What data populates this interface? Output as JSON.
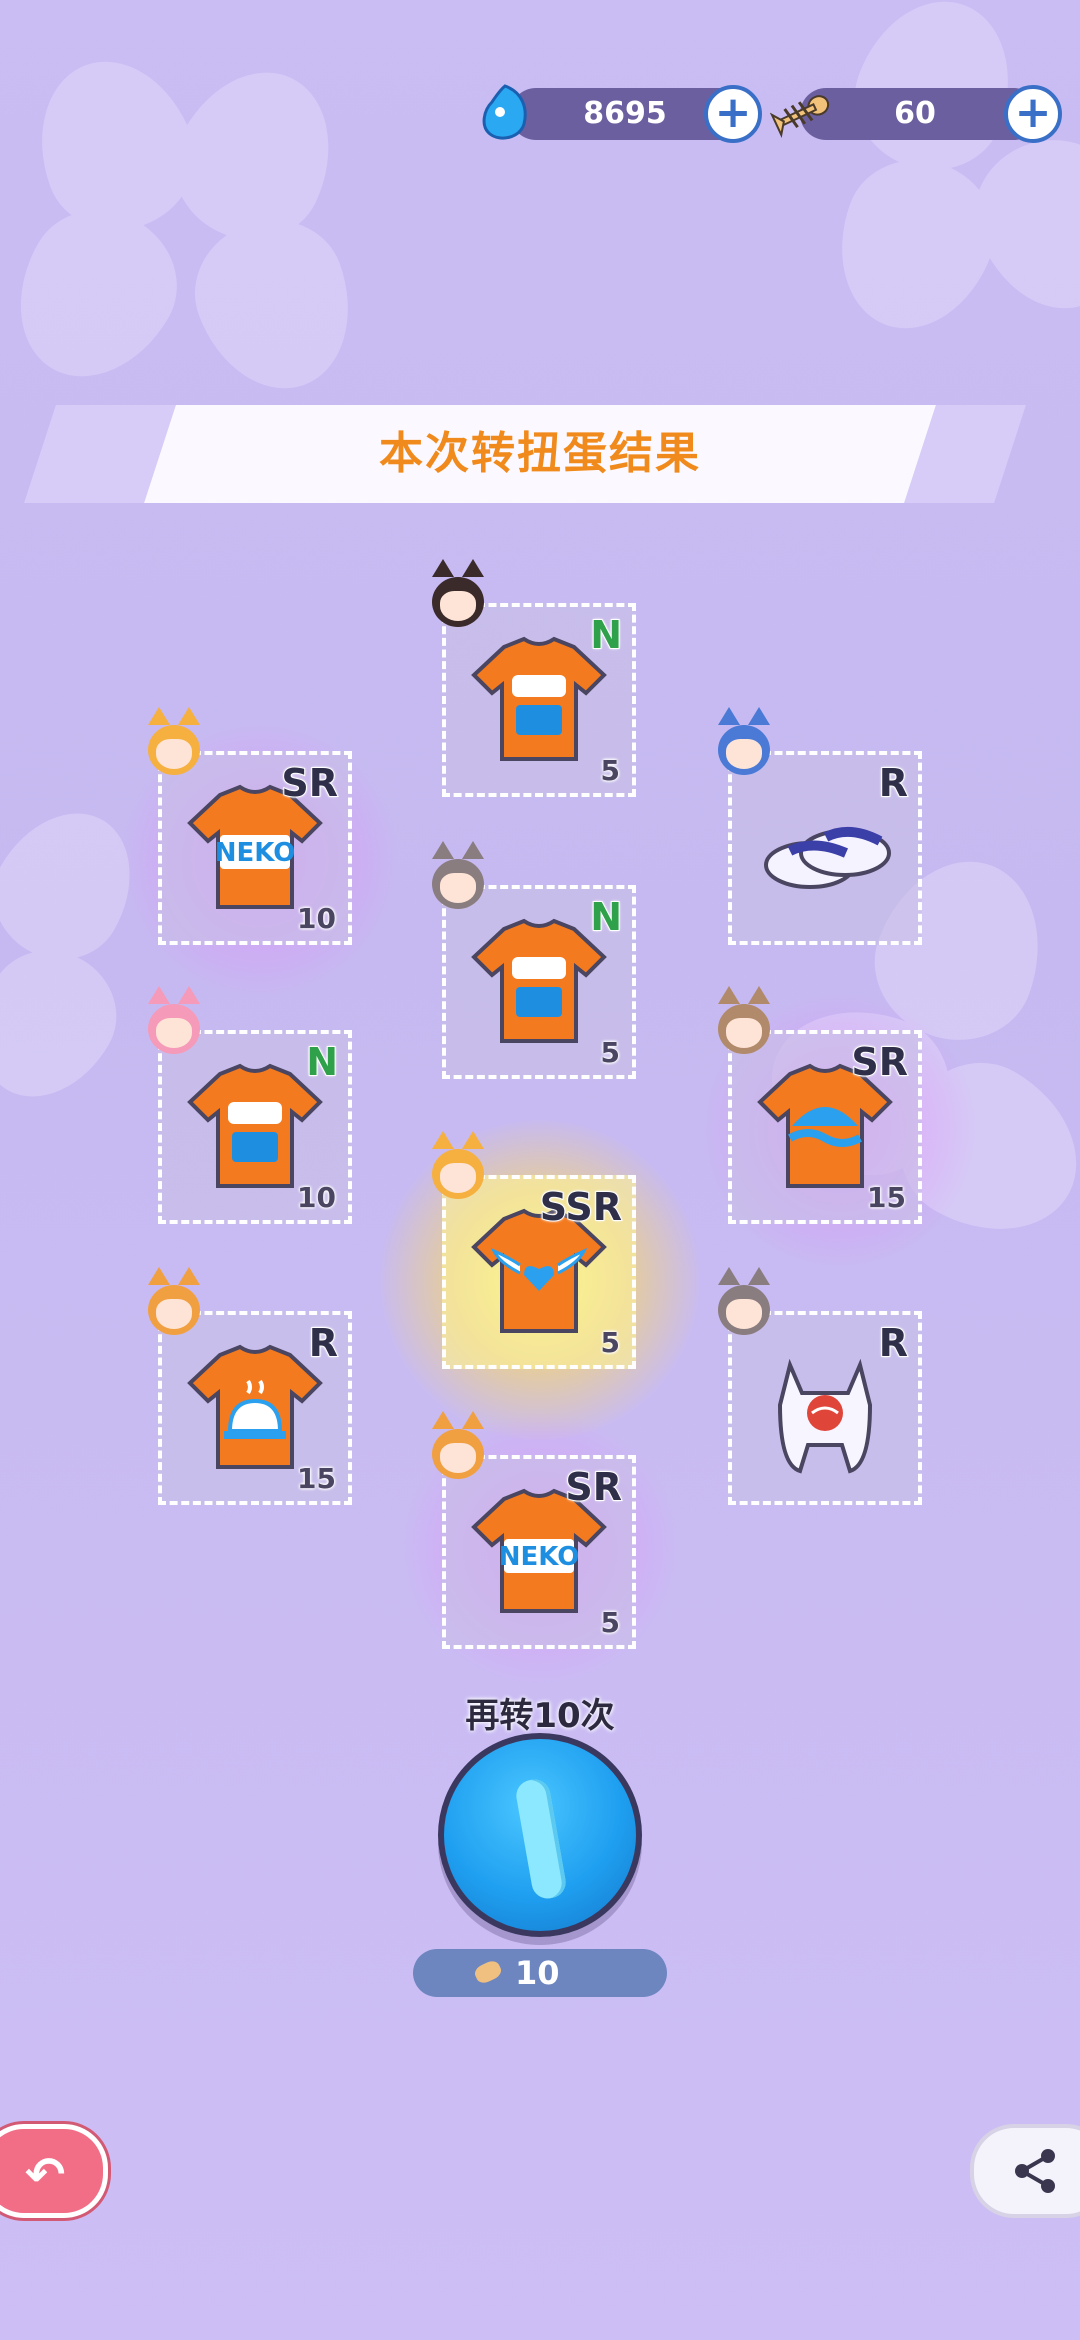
{
  "currencies": [
    {
      "name": "gem",
      "value": "8695",
      "icon": "gem-icon"
    },
    {
      "name": "fishbone",
      "value": "60",
      "icon": "fishbone-icon"
    }
  ],
  "banner": {
    "title": "本次转扭蛋结果"
  },
  "cards": [
    {
      "rarity": "N",
      "count": "5",
      "item": "tshirt-pangcilang",
      "slot": "top-center"
    },
    {
      "rarity": "SR",
      "count": "10",
      "item": "tshirt-neko",
      "slot": "left-1"
    },
    {
      "rarity": "R",
      "count": "",
      "item": "slippers",
      "slot": "right-1"
    },
    {
      "rarity": "N",
      "count": "5",
      "item": "tshirt-pangcilang",
      "slot": "center-2"
    },
    {
      "rarity": "N",
      "count": "10",
      "item": "tshirt-pangcilang",
      "slot": "left-2"
    },
    {
      "rarity": "SR",
      "count": "15",
      "item": "tshirt-cat-wave",
      "slot": "right-2"
    },
    {
      "rarity": "SSR",
      "count": "5",
      "item": "tshirt-winged-heart",
      "slot": "center-3"
    },
    {
      "rarity": "R",
      "count": "15",
      "item": "tshirt-bell",
      "slot": "left-3"
    },
    {
      "rarity": "R",
      "count": "",
      "item": "cat-hood",
      "slot": "right-3"
    },
    {
      "rarity": "SR",
      "count": "5",
      "item": "tshirt-neko",
      "slot": "center-4"
    }
  ],
  "spin_again": {
    "label": "再转10次",
    "cost": "10"
  },
  "colors": {
    "accent_orange": "#f08a1c",
    "button_blue": "#1f9ff0",
    "back_pink": "#f26d86"
  },
  "icons": {
    "back": "back-arrow-icon",
    "share": "share-icon"
  }
}
